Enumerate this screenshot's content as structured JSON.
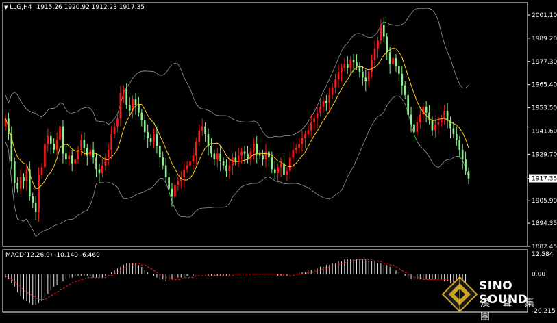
{
  "header": {
    "symbol": "LLG,H4",
    "ohlc": "1915.26 1920.92 1912.23 1917.35"
  },
  "macd": {
    "label": "MACD(12,26,9) -10.140 -6.460",
    "axis_top": "12.584",
    "axis_zero": "0.00",
    "axis_bottom": "-20.215"
  },
  "logo": {
    "name": "SINO SOUND",
    "chinese": "漢 聲 集 團"
  },
  "colors": {
    "up": "#ff1a1a",
    "down": "#8ef08e",
    "ma": "#ffd21a",
    "band": "#9a9a9a",
    "signal": "#ff2020",
    "grid": "#ffffff",
    "price_tag": "#ffffff"
  },
  "chart_data": [
    {
      "type": "candlestick",
      "title": "LLG,H4",
      "y_ticks": [
        2001.1,
        1989.2,
        1977.3,
        1965.4,
        1953.5,
        1941.6,
        1929.7,
        1917.35,
        1905.9,
        1894.35,
        1882.45
      ],
      "y_tick_labels": [
        "2001.10",
        "1989.20",
        "1977.30",
        "1965.40",
        "1953.50",
        "1941.60",
        "1929.70",
        "1917.35",
        "1905.90",
        "1894.35",
        "1882.45"
      ],
      "ylim": [
        1882.45,
        2007.4
      ],
      "current_price": 1917.35,
      "current_price_label": "1917.35",
      "close": [
        1948,
        1940,
        1926,
        1915,
        1912,
        1918,
        1916,
        1922,
        1908,
        1905,
        1900,
        1919,
        1923,
        1935,
        1939,
        1935,
        1932,
        1937,
        1944,
        1930,
        1927,
        1929,
        1925,
        1927,
        1932,
        1937,
        1933,
        1929,
        1932,
        1928,
        1922,
        1920,
        1924,
        1928,
        1932,
        1940,
        1944,
        1948,
        1961,
        1963,
        1955,
        1952,
        1958,
        1955,
        1951,
        1947,
        1941,
        1938,
        1936,
        1940,
        1934,
        1928,
        1924,
        1918,
        1912,
        1908,
        1914,
        1916,
        1918,
        1922,
        1924,
        1926,
        1929,
        1936,
        1942,
        1944,
        1940,
        1934,
        1930,
        1927,
        1930,
        1926,
        1924,
        1921,
        1924,
        1928,
        1926,
        1929,
        1931,
        1930,
        1927,
        1931,
        1935,
        1930,
        1929,
        1927,
        1931,
        1928,
        1922,
        1920,
        1923,
        1925,
        1919,
        1921,
        1928,
        1932,
        1933,
        1935,
        1938,
        1940,
        1942,
        1946,
        1948,
        1951,
        1954,
        1957,
        1956,
        1960,
        1964,
        1968,
        1972,
        1974,
        1976,
        1974,
        1978,
        1977,
        1975,
        1972,
        1969,
        1967,
        1972,
        1978,
        1984,
        1988,
        1996,
        1990,
        1982,
        1976,
        1979,
        1975,
        1971,
        1965,
        1960,
        1950,
        1945,
        1941,
        1946,
        1950,
        1954,
        1951,
        1947,
        1942,
        1945,
        1946,
        1948,
        1952,
        1947,
        1943,
        1940,
        1937,
        1932,
        1927,
        1921,
        1917.35
      ],
      "ma_color": "#ffd21a",
      "bands": "upper / lower envelope (grey)"
    },
    {
      "type": "bar",
      "title": "MACD(12,26,9)",
      "legend_values": {
        "macd": -10.14,
        "signal": -6.46
      },
      "ylim": [
        -20.215,
        12.584
      ],
      "y_tick_labels": [
        "12.584",
        "0.00",
        "-20.215"
      ],
      "values": [
        -2,
        -3,
        -5,
        -7,
        -10,
        -12,
        -14,
        -15,
        -16,
        -17,
        -17,
        -16,
        -15,
        -13,
        -11,
        -9,
        -7,
        -6,
        -5,
        -4,
        -3,
        -2,
        -2,
        -1,
        -1,
        -1,
        -1,
        -1,
        -1,
        -2,
        -2,
        -2,
        -2,
        -1,
        0,
        1,
        2,
        3,
        4,
        5,
        6,
        6,
        6,
        6,
        5,
        4,
        2,
        1,
        0,
        -1,
        -2,
        -3,
        -3,
        -4,
        -4,
        -3,
        -3,
        -2,
        -2,
        -2,
        -1,
        -1,
        -1,
        0,
        0,
        0,
        0,
        -1,
        -1,
        -1,
        -1,
        -1,
        -1,
        -1,
        -1,
        0,
        0,
        0,
        0,
        0,
        0,
        0,
        0,
        0,
        0,
        0,
        0,
        0,
        0,
        0,
        -1,
        -1,
        -1,
        -1,
        0,
        0,
        0,
        1,
        1,
        1,
        2,
        2,
        3,
        3,
        4,
        4,
        5,
        5,
        6,
        6,
        7,
        7,
        8,
        8,
        8,
        8,
        8,
        8,
        8,
        8,
        7,
        7,
        7,
        6,
        6,
        5,
        5,
        4,
        3,
        2,
        1,
        0,
        -1,
        -2,
        -3,
        -3,
        -3,
        -3,
        -3,
        -3,
        -3,
        -3,
        -3,
        -3,
        -3,
        -4,
        -4,
        -5,
        -6,
        -7,
        -8,
        -9,
        -10.14
      ],
      "signal": [
        -1,
        -2,
        -3,
        -4,
        -6,
        -7,
        -9,
        -10,
        -11,
        -12,
        -13,
        -14,
        -14,
        -14,
        -13,
        -12,
        -11,
        -10,
        -9,
        -8,
        -7,
        -6,
        -5,
        -4,
        -4,
        -3,
        -3,
        -2,
        -2,
        -2,
        -2,
        -2,
        -2,
        -2,
        -1,
        -1,
        0,
        1,
        2,
        3,
        4,
        5,
        5,
        6,
        6,
        5,
        5,
        4,
        3,
        2,
        1,
        0,
        -1,
        -2,
        -2,
        -3,
        -3,
        -3,
        -3,
        -2,
        -2,
        -2,
        -2,
        -1,
        -1,
        -1,
        -1,
        -1,
        -1,
        -1,
        -1,
        -1,
        -1,
        -1,
        -1,
        -1,
        0,
        0,
        0,
        0,
        0,
        0,
        0,
        0,
        0,
        0,
        0,
        0,
        0,
        0,
        0,
        0,
        -1,
        -1,
        -1,
        -1,
        0,
        0,
        0,
        0,
        1,
        1,
        1,
        2,
        2,
        3,
        3,
        4,
        4,
        5,
        5,
        6,
        6,
        7,
        7,
        7,
        8,
        8,
        8,
        8,
        8,
        8,
        7,
        7,
        7,
        6,
        6,
        5,
        5,
        4,
        3,
        2,
        1,
        0,
        -1,
        -2,
        -2,
        -2,
        -3,
        -3,
        -3,
        -3,
        -3,
        -3,
        -3,
        -3,
        -3,
        -4,
        -4,
        -5,
        -5,
        -6,
        -6.46
      ]
    }
  ]
}
